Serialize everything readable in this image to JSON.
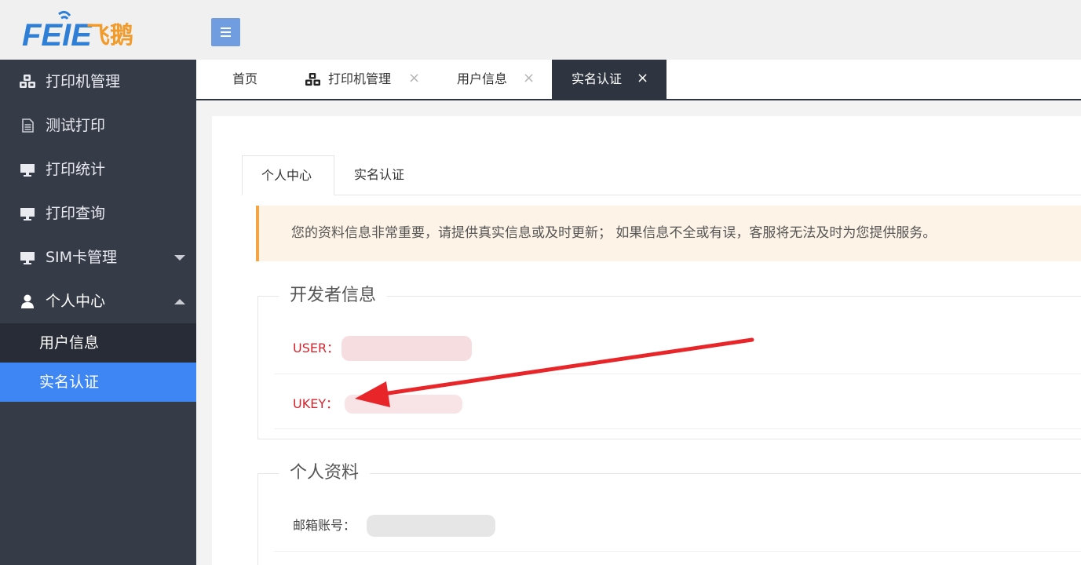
{
  "app": {
    "logo_text": "FEIE",
    "logo_chinese": "飞鹅"
  },
  "sidebar": {
    "items": [
      {
        "label": "打印机管理",
        "icon": "printers-cubes-icon"
      },
      {
        "label": "测试打印",
        "icon": "document-icon"
      },
      {
        "label": "打印统计",
        "icon": "monitor-icon"
      },
      {
        "label": "打印查询",
        "icon": "monitor-icon"
      },
      {
        "label": "SIM卡管理",
        "icon": "monitor-icon"
      },
      {
        "label": "个人中心",
        "icon": "user-icon"
      }
    ],
    "sub_items": [
      {
        "label": "用户信息"
      },
      {
        "label": "实名认证"
      }
    ]
  },
  "tabs": [
    {
      "label": "首页"
    },
    {
      "label": "打印机管理"
    },
    {
      "label": "用户信息"
    },
    {
      "label": "实名认证"
    }
  ],
  "close_glyph": "×",
  "inner_tabs": [
    {
      "label": "个人中心"
    },
    {
      "label": "实名认证"
    }
  ],
  "notice": {
    "text": "您的资料信息非常重要，请提供真实信息或及时更新； 如果信息不全或有误，客服将无法及时为您提供服务。"
  },
  "developer": {
    "title": "开发者信息",
    "user_label": "USER：",
    "ukey_label": "UKEY："
  },
  "profile": {
    "title": "个人资料",
    "email_label": "邮箱账号："
  },
  "colors": {
    "sidebar_bg": "#363b48",
    "active_blue": "#3d86f4",
    "warn_red": "#d9232d",
    "arrow_red": "#e8262a",
    "notice_border": "#f5a545"
  }
}
